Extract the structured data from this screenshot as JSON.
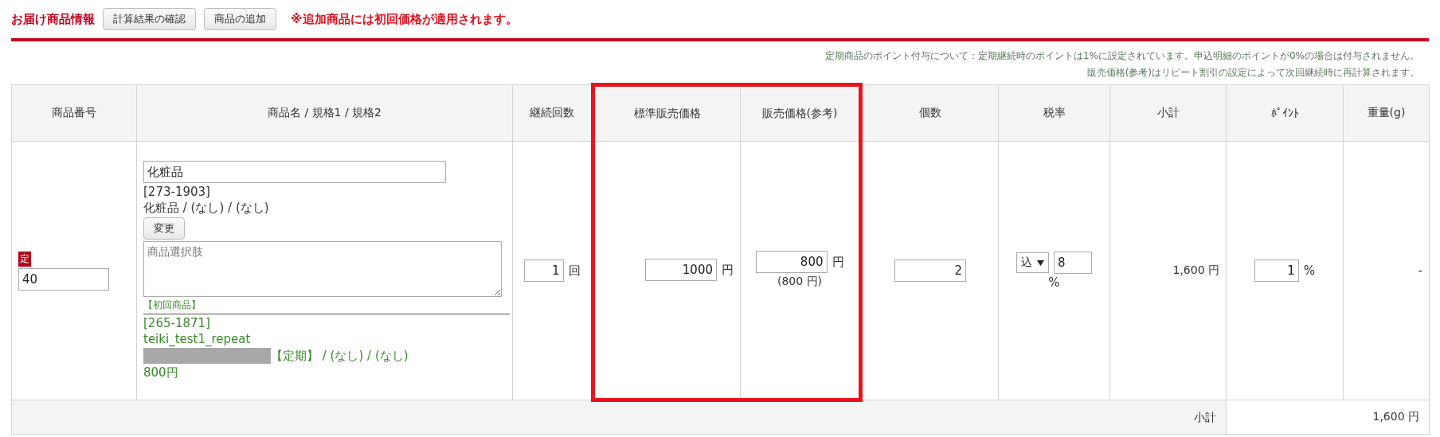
{
  "header": {
    "title": "お届け商品情報",
    "buttons": [
      "計算結果の確認",
      "商品の追加"
    ],
    "notice": "※追加商品には初回価格が適用されます。"
  },
  "notes": [
    "定期商品のポイント付与について：定期継続時のポイントは1%に設定されています。申込明細のポイントが0%の場合は付与されません。",
    "販売価格(参考)はリピート割引の設定によって次回継続時に再計算されます。"
  ],
  "table": {
    "columns": [
      {
        "label": "商品番号",
        "highlighted": false
      },
      {
        "label": "商品名 / 規格1 / 規格2",
        "highlighted": false
      },
      {
        "label": "継続回数",
        "highlighted": false
      },
      {
        "label": "標準販売価格",
        "highlighted": true
      },
      {
        "label": "販売価格(参考)",
        "highlighted": true
      },
      {
        "label": "個数",
        "highlighted": false
      },
      {
        "label": "税率",
        "highlighted": false
      },
      {
        "label": "小計",
        "highlighted": false
      },
      {
        "label": "ﾎﾟｲﾝﾄ",
        "highlighted": false
      },
      {
        "label": "重量(g)",
        "highlighted": false
      }
    ],
    "row": {
      "product_number": {
        "badge": "定",
        "value": "40"
      },
      "product": {
        "name": "化粧品",
        "code": "[273-1903]",
        "spec": "化粧品 / (なし) / (なし)",
        "change_button": "変更",
        "options_placeholder": "商品選択肢",
        "first_label": "【初回商品】",
        "repeat_code": "[265-1871]",
        "repeat_name": "teiki_test1_repeat",
        "repeat_spec": "【定期】 / (なし) / (なし)",
        "repeat_price": "800円"
      },
      "continuation": {
        "value": "1",
        "unit": "回"
      },
      "standard_price": {
        "value": "1000",
        "unit": "円"
      },
      "sale_price": {
        "value": "800",
        "unit": "円",
        "reference": "(800 円)"
      },
      "quantity": "2",
      "tax": {
        "mode": "込",
        "rate": "8",
        "unit": "%"
      },
      "subtotal": "1,600 円",
      "points": {
        "value": "1",
        "unit": "%"
      },
      "weight": "-"
    },
    "subtotal": {
      "label": "小計",
      "value": "1,600 円"
    }
  }
}
